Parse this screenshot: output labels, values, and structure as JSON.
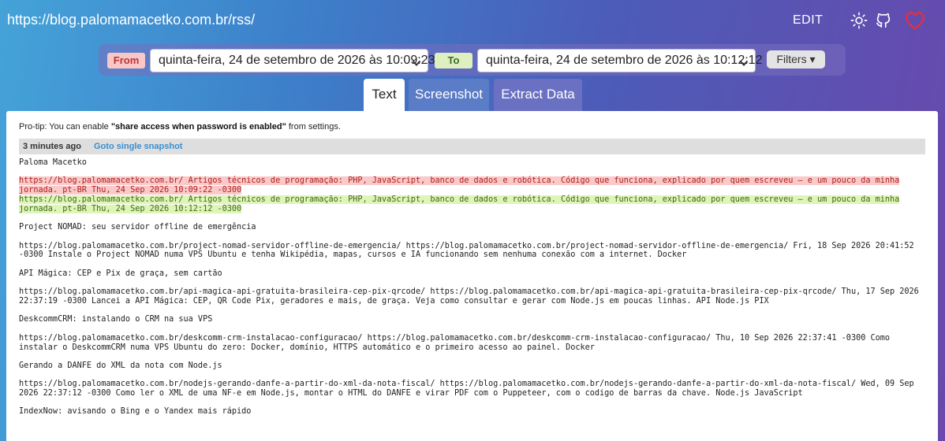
{
  "header": {
    "url": "https://blog.palomamacetko.com.br/rss/",
    "edit_label": "EDIT"
  },
  "icons": {
    "theme": "sun-icon",
    "github": "github-icon",
    "heart": "heart-icon"
  },
  "colors": {
    "heart": "#e03040",
    "removed_bg": "#fac9c9",
    "added_bg": "#dff4b8",
    "link": "#3a8fd0"
  },
  "controls": {
    "from_label": "From",
    "from_value": "quinta-feira, 24 de setembro de 2026 às 10:09:23",
    "to_label": "To",
    "to_value": "quinta-feira, 24 de setembro de 2026 às 10:12:12",
    "filters_label": "Filters ▾"
  },
  "tabs": [
    {
      "label": "Text"
    },
    {
      "label": "Screenshot"
    },
    {
      "label": "Extract Data"
    }
  ],
  "protip": {
    "prefix": "Pro-tip: You can enable ",
    "bold": "\"share access when password is enabled\"",
    "suffix": " from settings."
  },
  "snapshot": {
    "ago": "3 minutes ago",
    "goto": "Goto single snapshot"
  },
  "diff": {
    "title": "Paloma Macetko",
    "removed": [
      "https://blog.palomamacetko.com.br/ Artigos técnicos de programação: PHP, JavaScript, banco de dados e robótica. Código que funciona, explicado por quem escreveu — e um pouco da minha",
      "jornada. pt-BR Thu, 24 Sep 2026 10:09:22 -0300"
    ],
    "added": [
      "https://blog.palomamacetko.com.br/ Artigos técnicos de programação: PHP, JavaScript, banco de dados e robótica. Código que funciona, explicado por quem escreveu — e um pouco da minha",
      "jornada. pt-BR Thu, 24 Sep 2026 10:12:12 -0300"
    ],
    "items": [
      {
        "title": "Project NOMAD: seu servidor offline de emergência",
        "lines": [
          "https://blog.palomamacetko.com.br/project-nomad-servidor-offline-de-emergencia/ https://blog.palomamacetko.com.br/project-nomad-servidor-offline-de-emergencia/ Fri, 18 Sep 2026 20:41:52",
          "-0300 Instale o Project NOMAD numa VPS Ubuntu e tenha Wikipédia, mapas, cursos e IA funcionando sem nenhuma conexão com a internet. Docker"
        ]
      },
      {
        "title": "API Mágica: CEP e Pix de graça, sem cartão",
        "lines": [
          "https://blog.palomamacetko.com.br/api-magica-api-gratuita-brasileira-cep-pix-qrcode/ https://blog.palomamacetko.com.br/api-magica-api-gratuita-brasileira-cep-pix-qrcode/ Thu, 17 Sep 2026",
          "22:37:19 -0300 Lancei a API Mágica: CEP, QR Code Pix, geradores e mais, de graça. Veja como consultar e gerar com Node.js em poucas linhas. API Node.js PIX"
        ]
      },
      {
        "title": "DeskcommCRM: instalando o CRM na sua VPS",
        "lines": [
          "https://blog.palomamacetko.com.br/deskcomm-crm-instalacao-configuracao/ https://blog.palomamacetko.com.br/deskcomm-crm-instalacao-configuracao/ Thu, 10 Sep 2026 22:37:41 -0300 Como",
          "instalar o DeskcommCRM numa VPS Ubuntu do zero: Docker, domínio, HTTPS automático e o primeiro acesso ao painel. Docker"
        ]
      },
      {
        "title": "Gerando a DANFE do XML da nota com Node.js",
        "lines": [
          "https://blog.palomamacetko.com.br/nodejs-gerando-danfe-a-partir-do-xml-da-nota-fiscal/ https://blog.palomamacetko.com.br/nodejs-gerando-danfe-a-partir-do-xml-da-nota-fiscal/ Wed, 09 Sep",
          "2026 22:37:12 -0300 Como ler o XML de uma NF-e em Node.js, montar o HTML do DANFE e virar PDF com o Puppeteer, com o codigo de barras da chave. Node.js JavaScript"
        ]
      },
      {
        "title": "IndexNow: avisando o Bing e o Yandex mais rápido",
        "lines": []
      }
    ]
  }
}
